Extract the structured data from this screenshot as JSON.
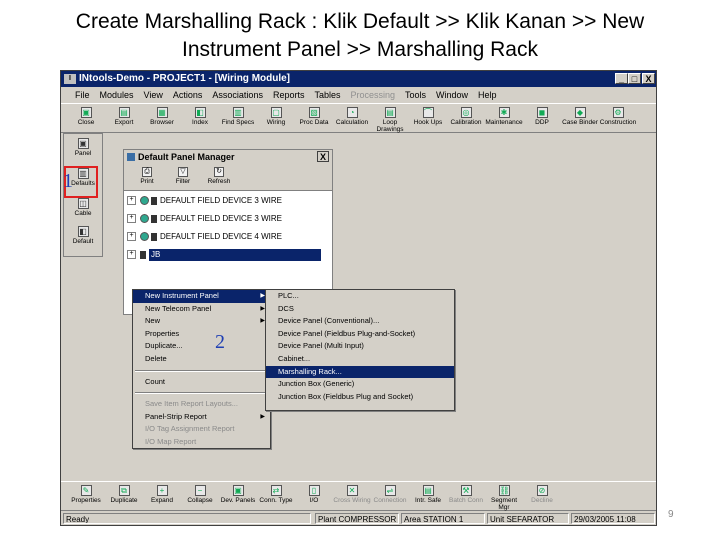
{
  "slide": {
    "title_line1": "Create Marshalling Rack : Klik Default >> Klik Kanan >> New",
    "title_line2": "Instrument Panel >> Marshalling Rack",
    "page_number": "9"
  },
  "window": {
    "title": "INtools-Demo - PROJECT1 - [Wiring Module]",
    "controls": [
      "_",
      "□",
      "X"
    ]
  },
  "menubar": [
    "File",
    "Modules",
    "View",
    "Actions",
    "Associations",
    "Reports",
    "Tables",
    "Processing",
    "Tools",
    "Window",
    "Help"
  ],
  "toolbar": [
    "Close",
    "Export",
    "Browser",
    "Index",
    "Find Specs",
    "Wiring",
    "Proc Data",
    "Calculation",
    "Loop Drawings",
    "Hook Ups",
    "Calibration",
    "Maintenance",
    "DDP",
    "Case Binder",
    "Construction"
  ],
  "leftbar": [
    "Panel",
    "Defaults",
    "Cable",
    "Default"
  ],
  "annotations": {
    "step1": "1",
    "step2": "2"
  },
  "panel_manager": {
    "title": "Default Panel Manager",
    "close": "X",
    "tools": [
      "Print",
      "Filter",
      "Refresh"
    ],
    "tree": [
      {
        "label": "DEFAULT FIELD DEVICE 3 WIRE"
      },
      {
        "label": "DEFAULT FIELD DEVICE 3 WIRE"
      },
      {
        "label": "DEFAULT FIELD DEVICE 4 WIRE"
      },
      {
        "label": "JB"
      }
    ]
  },
  "context_menu": [
    "New Instrument Panel",
    "New Telecom Panel",
    "New",
    "Properties",
    "Duplicate...",
    "Delete",
    "Count",
    "Save Item Report Layouts...",
    "Panel-Strip Report",
    "I/O Tag Assignment Report",
    "I/O Map Report"
  ],
  "submenu": [
    "PLC...",
    "DCS",
    "Device Panel (Conventional)...",
    "Device Panel (Fieldbus Plug-and-Socket)",
    "Device Panel (Multi Input)",
    "Cabinet...",
    "Marshalling Rack...",
    "Junction Box (Generic)",
    "Junction Box (Fieldbus Plug and Socket)"
  ],
  "bottom_toolbar": [
    "Properties",
    "Duplicate",
    "Expand",
    "Collapse",
    "Dev. Panels",
    "Conn. Type",
    "I/O",
    "Cross Wiring",
    "Connection",
    "Intr. Safe",
    "Batch Conn",
    "Segment Mgr",
    "Decline"
  ],
  "status": {
    "text": "Ready",
    "plant": "Plant COMPRESSOR",
    "area": "Area STATION 1",
    "unit": "Unit SEFARATOR",
    "datetime": "29/03/2005 11:08"
  },
  "colors": {
    "title_bar": "#0a246a",
    "selection": "#0a246a",
    "highlight_box": "#e02020",
    "annotation": "#1f3fb3"
  }
}
